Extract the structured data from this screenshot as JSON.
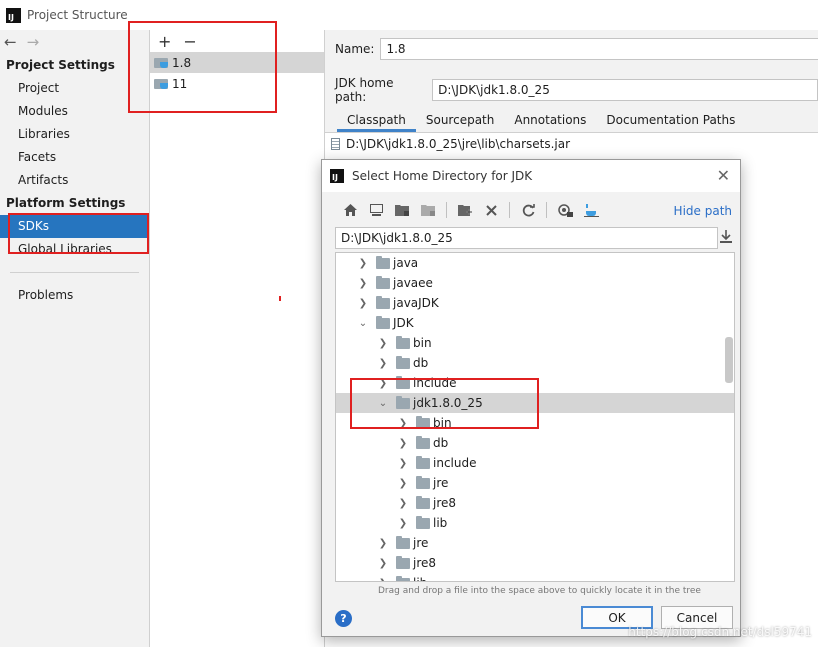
{
  "window": {
    "title": "Project Structure"
  },
  "nav": {
    "back": "←",
    "forward": "→"
  },
  "left": {
    "project_settings_header": "Project Settings",
    "project_items": [
      "Project",
      "Modules",
      "Libraries",
      "Facets",
      "Artifacts"
    ],
    "platform_settings_header": "Platform Settings",
    "platform_items": [
      "SDKs",
      "Global Libraries"
    ],
    "selected": "SDKs",
    "problems": "Problems"
  },
  "middle": {
    "add": "+",
    "remove": "−",
    "sdks": [
      "1.8",
      "11"
    ],
    "selected": "1.8"
  },
  "details": {
    "name_label": "Name:",
    "name_value": "1.8",
    "home_label": "JDK home path:",
    "home_value": "D:\\JDK\\jdk1.8.0_25",
    "tabs": [
      "Classpath",
      "Sourcepath",
      "Annotations",
      "Documentation Paths"
    ],
    "active_tab": "Classpath",
    "classpath": [
      "D:\\JDK\\jdk1.8.0_25\\jre\\lib\\charsets.jar"
    ]
  },
  "dialog": {
    "title": "Select Home Directory for JDK",
    "close": "✕",
    "hide_path": "Hide path",
    "path_value": "D:\\JDK\\jdk1.8.0_25",
    "tree": [
      {
        "label": "java",
        "expanded": false
      },
      {
        "label": "javaee",
        "expanded": false
      },
      {
        "label": "javaJDK",
        "expanded": false
      },
      {
        "label": "JDK",
        "expanded": true
      },
      {
        "label": "bin",
        "expanded": false
      },
      {
        "label": "db",
        "expanded": false
      },
      {
        "label": "include",
        "expanded": false
      },
      {
        "label": "jdk1.8.0_25",
        "expanded": true
      },
      {
        "label": "bin",
        "expanded": false
      },
      {
        "label": "db",
        "expanded": false
      },
      {
        "label": "include",
        "expanded": false
      },
      {
        "label": "jre",
        "expanded": false
      },
      {
        "label": "jre8",
        "expanded": false
      },
      {
        "label": "lib",
        "expanded": false
      },
      {
        "label": "jre",
        "expanded": false
      },
      {
        "label": "jre8",
        "expanded": false
      },
      {
        "label": "lib",
        "expanded": false
      }
    ],
    "selected_item": "jdk1.8.0_25",
    "drop_hint": "Drag and drop a file into the space above to quickly locate it in the tree",
    "help": "?",
    "ok": "OK",
    "cancel": "Cancel",
    "toolbar_icons": [
      "home-icon",
      "desktop-icon",
      "project-folder-icon",
      "module-folder-icon",
      "new-folder-icon",
      "delete-icon",
      "refresh-icon",
      "show-hidden-icon",
      "jdk-home-icon"
    ]
  },
  "watermark": "https://blog.csdn.net/dsl59741",
  "colors": {
    "selection": "#2675bf",
    "annotation_red": "#e02020",
    "link": "#2a6ec7"
  }
}
